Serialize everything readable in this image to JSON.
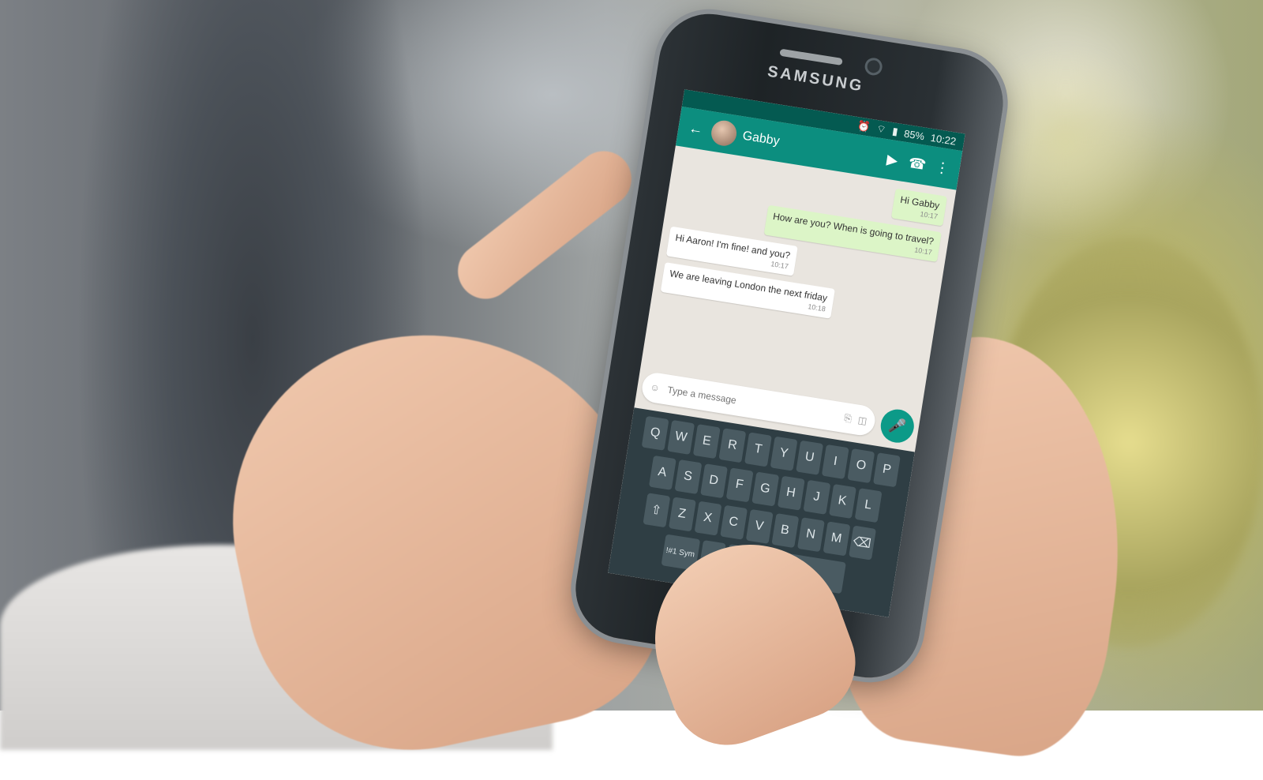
{
  "phone": {
    "brand": "SAMSUNG",
    "status_time": "10:22",
    "status_battery": "85%"
  },
  "chat": {
    "contact_name": "Gabby",
    "messages": [
      {
        "direction": "out",
        "text": "Hi Gabby",
        "time": "10:17"
      },
      {
        "direction": "out",
        "text": "How are you? When is going to travel?",
        "time": "10:17"
      },
      {
        "direction": "in",
        "text": "Hi Aaron! I'm fine! and you?",
        "time": "10:17"
      },
      {
        "direction": "in",
        "text": "We are leaving London the next friday",
        "time": "10:18"
      }
    ],
    "input_placeholder": "Type a message"
  },
  "keyboard": {
    "row1": [
      "Q",
      "W",
      "E",
      "R",
      "T",
      "Y",
      "U",
      "I",
      "O",
      "P"
    ],
    "row2": [
      "A",
      "S",
      "D",
      "F",
      "G",
      "H",
      "J",
      "K",
      "L"
    ],
    "row3": [
      "Z",
      "X",
      "C",
      "V",
      "B",
      "N",
      "M"
    ],
    "symbols_key": "!#1 Sym"
  },
  "icons": {
    "video": "video-call-icon",
    "call": "phone-icon",
    "emoji": "emoji-icon",
    "attach": "paperclip-icon",
    "camera": "camera-icon",
    "mic": "mic-icon",
    "backspace": "backspace-icon",
    "shift": "shift-icon"
  },
  "colors": {
    "toolbar": "#0c8e7f",
    "statusbar": "#045a51",
    "outgoing_bubble": "#dcf5c7",
    "incoming_bubble": "#ffffff",
    "mic_button": "#0c9a88"
  }
}
